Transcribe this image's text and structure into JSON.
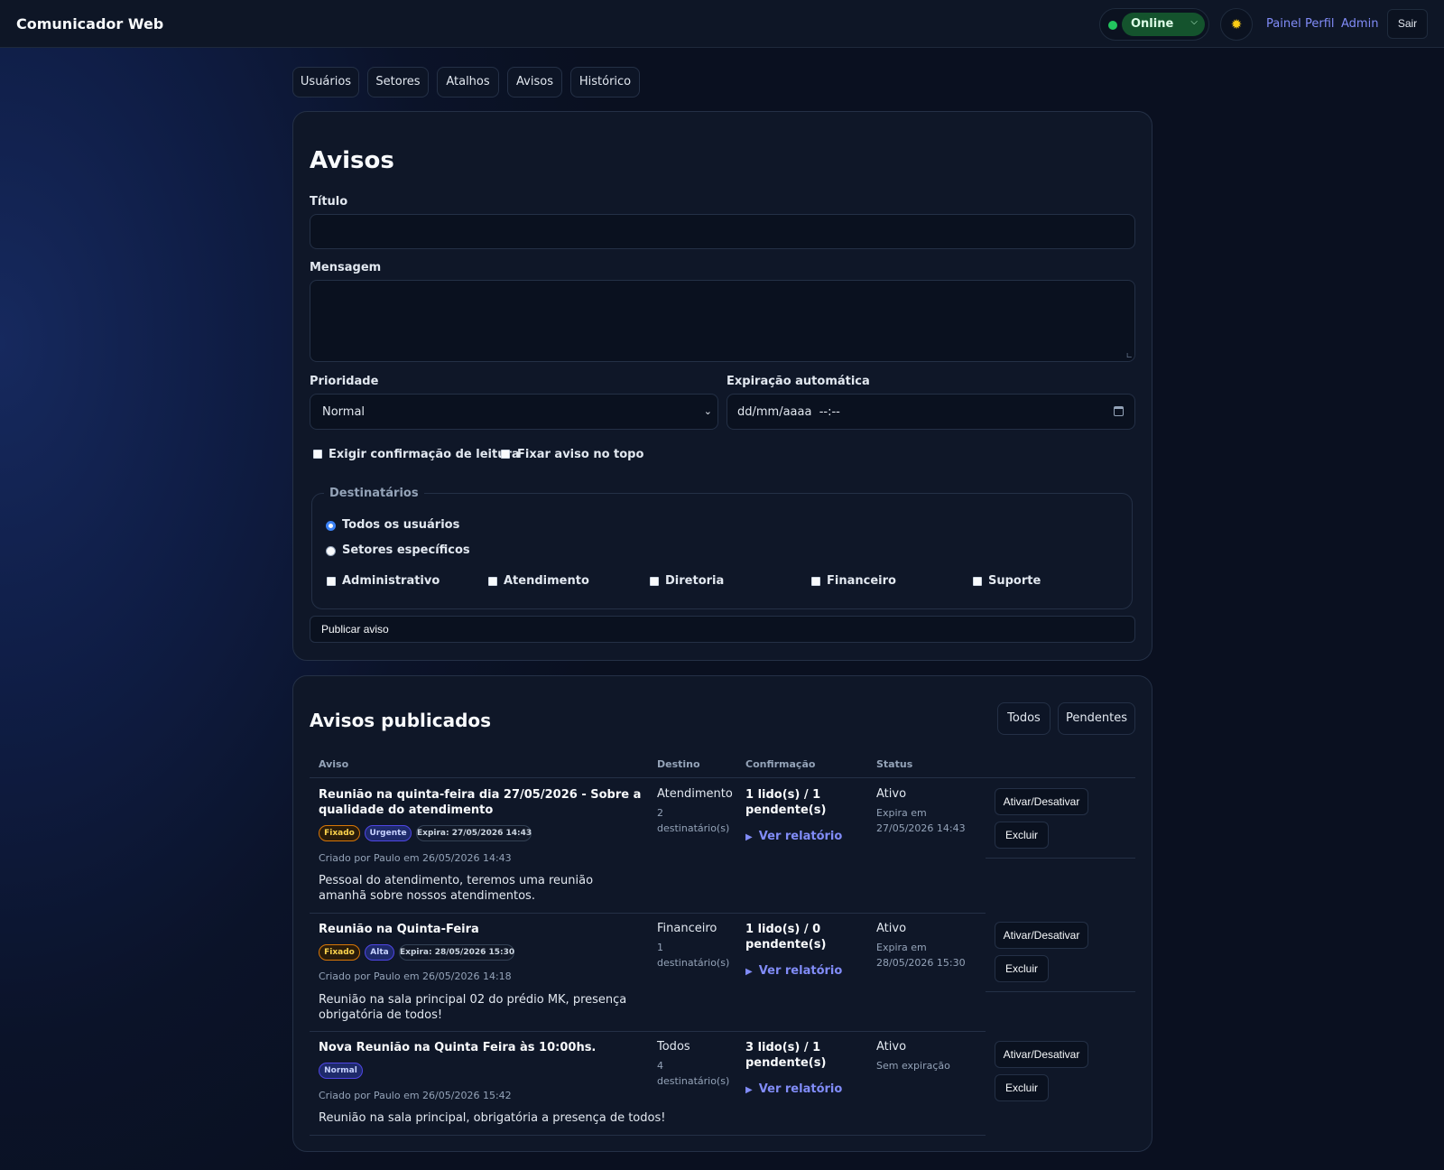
{
  "header": {
    "brand": "Comunicador Web",
    "status": "Online",
    "status_color": "#22c55e",
    "theme_icon": "sun-icon",
    "nav": [
      "Painel",
      "Perfil",
      "Admin"
    ],
    "logout": "Sair"
  },
  "tabs": [
    "Usuários",
    "Setores",
    "Atalhos",
    "Avisos",
    "Histórico"
  ],
  "form": {
    "heading": "Avisos",
    "title_label": "Título",
    "title_value": "",
    "message_label": "Mensagem",
    "message_value": "",
    "priority_label": "Prioridade",
    "priority_value": "Normal",
    "expiration_label": "Expiração automática",
    "expiration_placeholder": "dd/mm/aaaa  --:--",
    "require_read_label": "Exigir confirmação de leitura",
    "pin_label": "Fixar aviso no topo",
    "recipients_legend": "Destinatários",
    "radio_all": "Todos os usuários",
    "radio_sectors": "Setores específicos",
    "sectors": [
      "Administrativo",
      "Atendimento",
      "Diretoria",
      "Financeiro",
      "Suporte"
    ],
    "publish_button": "Publicar aviso"
  },
  "published": {
    "heading": "Avisos publicados",
    "filter_all": "Todos",
    "filter_pending": "Pendentes",
    "columns": [
      "Aviso",
      "Destino",
      "Confirmação",
      "Status"
    ],
    "rows": [
      {
        "title": "Reunião na quinta-feira dia 27/05/2026 - Sobre a qualidade do atendimento",
        "badges": [
          "Fixado",
          "Urgente",
          "Expira: 27/05/2026 14:43"
        ],
        "created": "Criado por Paulo em 26/05/2026 14:43",
        "message": "Pessoal do atendimento, teremos uma reunião amanhã sobre nossos atendimentos.",
        "destination": "Atendimento",
        "recipients": "2 destinatário(s)",
        "confirmation": "1 lido(s) / 1 pendente(s)",
        "report": "Ver relatório",
        "status": "Ativo",
        "status_detail": "Expira em 27/05/2026 14:43",
        "toggle": "Ativar/Desativar",
        "delete": "Excluir"
      },
      {
        "title": "Reunião na Quinta-Feira",
        "badges": [
          "Fixado",
          "Alta",
          "Expira: 28/05/2026 15:30"
        ],
        "created": "Criado por Paulo em 26/05/2026 14:18",
        "message": "Reunião na sala principal 02 do prédio MK, presença obrigatória de todos!",
        "destination": "Financeiro",
        "recipients": "1 destinatário(s)",
        "confirmation": "1 lido(s) / 0 pendente(s)",
        "report": "Ver relatório",
        "status": "Ativo",
        "status_detail": "Expira em 28/05/2026 15:30",
        "toggle": "Ativar/Desativar",
        "delete": "Excluir"
      },
      {
        "title": "Nova Reunião na Quinta Feira às 10:00hs.",
        "badges": [
          "Normal"
        ],
        "created": "Criado por Paulo em 26/05/2026 15:42",
        "message": "Reunião na sala principal, obrigatória a presença de todos!",
        "destination": "Todos",
        "recipients": "4 destinatário(s)",
        "confirmation": "3 lido(s) / 1 pendente(s)",
        "report": "Ver relatório",
        "status": "Ativo",
        "status_detail": "Sem expiração",
        "toggle": "Ativar/Desativar",
        "delete": "Excluir"
      }
    ]
  }
}
